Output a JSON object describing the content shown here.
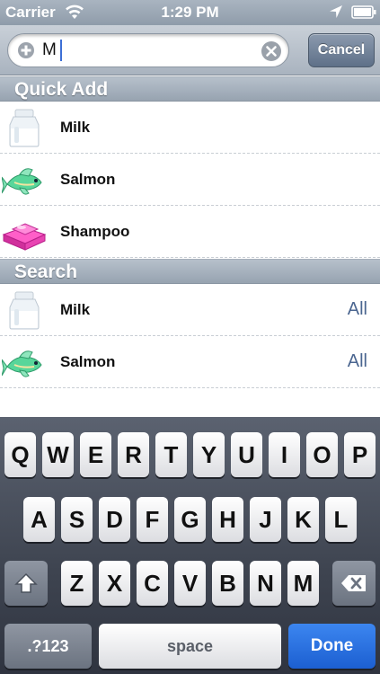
{
  "status_bar": {
    "carrier": "Carrier",
    "time": "1:29 PM"
  },
  "search": {
    "query": "M",
    "cancel_label": "Cancel"
  },
  "quick_add": {
    "title": "Quick Add",
    "items": [
      {
        "label": "Milk",
        "icon": "milk-icon"
      },
      {
        "label": "Salmon",
        "icon": "fish-icon"
      },
      {
        "label": "Shampoo",
        "icon": "soap-icon"
      }
    ]
  },
  "search_results": {
    "title": "Search",
    "items": [
      {
        "label": "Milk",
        "detail": "All",
        "icon": "milk-icon"
      },
      {
        "label": "Salmon",
        "detail": "All",
        "icon": "fish-icon"
      }
    ]
  },
  "keyboard": {
    "row1": [
      "Q",
      "W",
      "E",
      "R",
      "T",
      "Y",
      "U",
      "I",
      "O",
      "P"
    ],
    "row2": [
      "A",
      "S",
      "D",
      "F",
      "G",
      "H",
      "J",
      "K",
      "L"
    ],
    "row3": [
      "Z",
      "X",
      "C",
      "V",
      "B",
      "N",
      "M"
    ],
    "numbers_label": ".?123",
    "space_label": "space",
    "done_label": "Done"
  },
  "colors": {
    "accent": "#1c5fd1",
    "detail_text": "#4b6690"
  }
}
